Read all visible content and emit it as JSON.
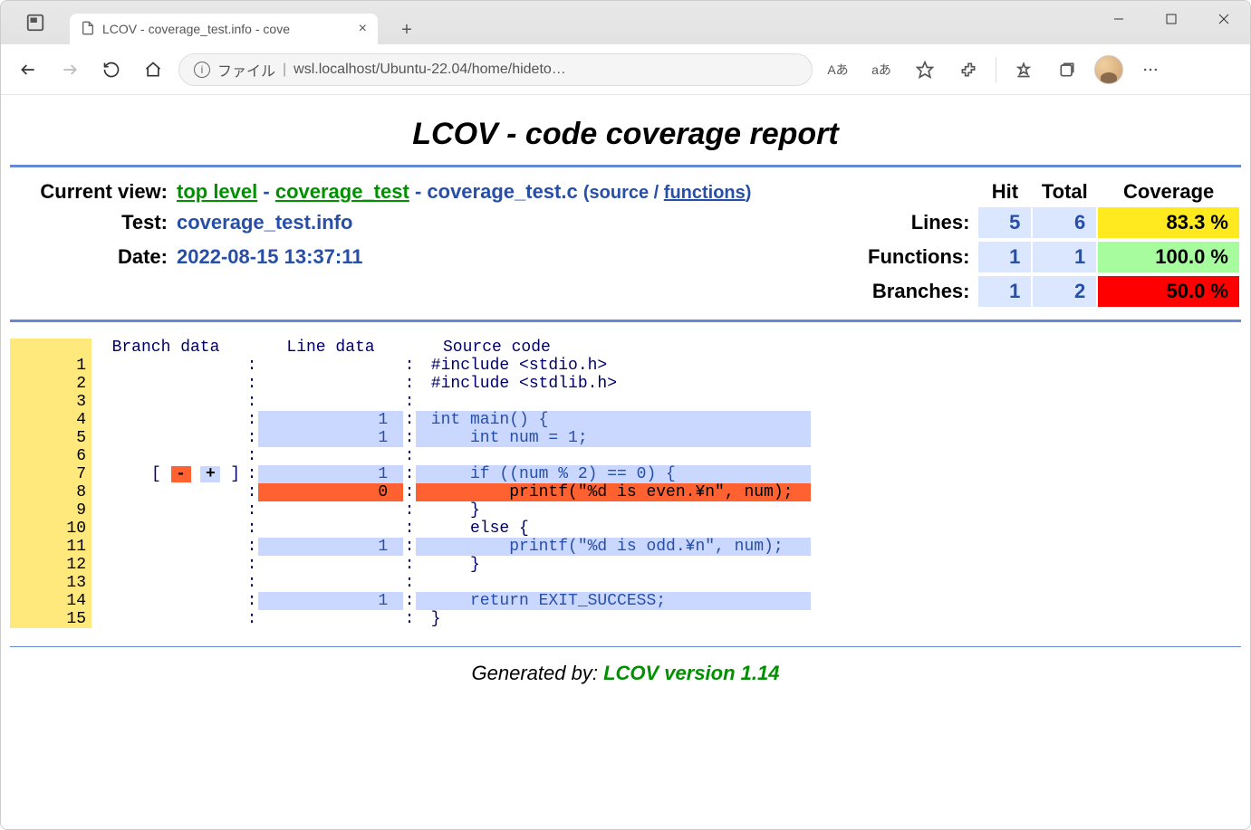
{
  "window": {
    "tab_title": "LCOV - coverage_test.info - cove",
    "close_tab": "×",
    "new_tab": "+",
    "url_label": "ファイル",
    "url_sep": "|",
    "url": "wsl.localhost/Ubuntu-22.04/home/hideto…",
    "read_aloud": "Aあ",
    "translate": "aあ"
  },
  "report": {
    "title": "LCOV - code coverage report",
    "current_view_label": "Current view:",
    "top_level": "top level",
    "dash": " - ",
    "dir": "coverage_test",
    "file": "coverage_test.c",
    "paren_source": "source",
    "paren_slash": " / ",
    "paren_functions": "functions",
    "test_label": "Test:",
    "test_value": "coverage_test.info",
    "date_label": "Date:",
    "date_value": "2022-08-15 13:37:11",
    "metrics": {
      "hit_header": "Hit",
      "total_header": "Total",
      "coverage_header": "Coverage",
      "lines_label": "Lines:",
      "lines_hit": "5",
      "lines_total": "6",
      "lines_cov": "83.3 %",
      "functions_label": "Functions:",
      "functions_hit": "1",
      "functions_total": "1",
      "functions_cov": "100.0 %",
      "branches_label": "Branches:",
      "branches_hit": "1",
      "branches_total": "2",
      "branches_cov": "50.0 %"
    }
  },
  "source": {
    "headers": {
      "branch": "Branch data",
      "linedata": "Line data",
      "code": "Source code"
    },
    "branch_row7_pre": "[ ",
    "branch_row7_minus": "-",
    "branch_row7_plus": "+",
    "branch_row7_post": " ]",
    "lines": [
      {
        "n": "1",
        "sep": ":",
        "count": "",
        "csep": ":",
        "src": " #include <stdio.h>",
        "hl": "none"
      },
      {
        "n": "2",
        "sep": ":",
        "count": "",
        "csep": ":",
        "src": " #include <stdlib.h>",
        "hl": "none"
      },
      {
        "n": "3",
        "sep": ":",
        "count": "",
        "csep": ":",
        "src": "",
        "hl": "none"
      },
      {
        "n": "4",
        "sep": ":",
        "count": "1 ",
        "csep": ":",
        "src": " int main() {",
        "hl": "hit"
      },
      {
        "n": "5",
        "sep": ":",
        "count": "1 ",
        "csep": ":",
        "src": "     int num = 1;",
        "hl": "hit"
      },
      {
        "n": "6",
        "sep": ":",
        "count": "",
        "csep": ":",
        "src": "",
        "hl": "none"
      },
      {
        "n": "7",
        "sep": ":",
        "count": "1 ",
        "csep": ":",
        "src": "     if ((num % 2) == 0) {",
        "hl": "hit"
      },
      {
        "n": "8",
        "sep": ":",
        "count": "0 ",
        "csep": ":",
        "src": "         printf(\"%d is even.¥n\", num);",
        "hl": "miss"
      },
      {
        "n": "9",
        "sep": ":",
        "count": "",
        "csep": ":",
        "src": "     }",
        "hl": "none"
      },
      {
        "n": "10",
        "sep": ":",
        "count": "",
        "csep": ":",
        "src": "     else {",
        "hl": "none"
      },
      {
        "n": "11",
        "sep": ":",
        "count": "1 ",
        "csep": ":",
        "src": "         printf(\"%d is odd.¥n\", num);",
        "hl": "hit"
      },
      {
        "n": "12",
        "sep": ":",
        "count": "",
        "csep": ":",
        "src": "     }",
        "hl": "none"
      },
      {
        "n": "13",
        "sep": ":",
        "count": "",
        "csep": ":",
        "src": "",
        "hl": "none"
      },
      {
        "n": "14",
        "sep": ":",
        "count": "1 ",
        "csep": ":",
        "src": "     return EXIT_SUCCESS;",
        "hl": "hit"
      },
      {
        "n": "15",
        "sep": ":",
        "count": "",
        "csep": ":",
        "src": " }",
        "hl": "none"
      }
    ]
  },
  "footer": {
    "gen_label": "Generated by: ",
    "gen_link": "LCOV version 1.14"
  }
}
